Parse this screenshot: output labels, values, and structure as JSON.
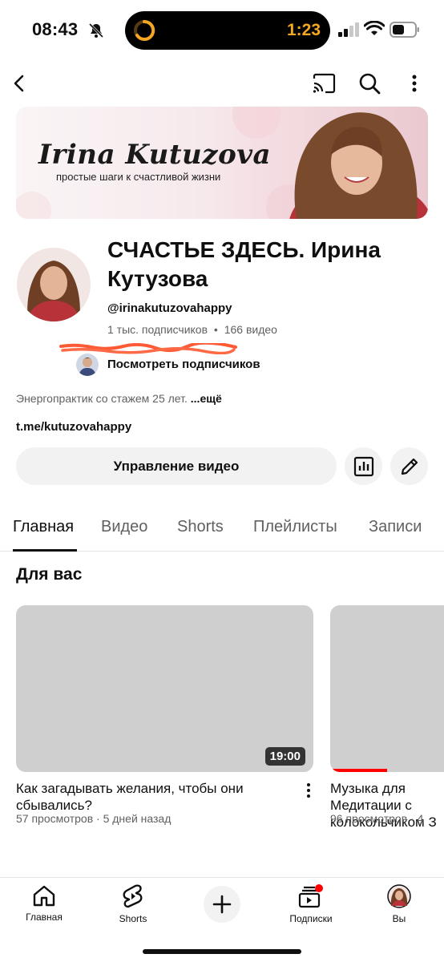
{
  "status_bar": {
    "time": "08:43",
    "timer": "1:23"
  },
  "banner": {
    "title": "Irina Kutuzova",
    "subtitle": "простые шаги к счастливой жизни"
  },
  "channel": {
    "name": "СЧАСТЬЕ ЗДЕСЬ. Ирина Кутузова",
    "handle": "@irinakutuzovahappy",
    "subscribers": "1 тыс. подписчиков",
    "separator": "•",
    "videos_count": "166 видео",
    "see_subscribers": "Посмотреть подписчиков",
    "description": "Энергопрактик со стажем 25 лет.",
    "more": "...ещё",
    "link": "t.me/kutuzovahappy",
    "manage_button": "Управление видео"
  },
  "tabs": [
    "Главная",
    "Видео",
    "Shorts",
    "Плейлисты",
    "Записи"
  ],
  "section": {
    "title": "Для вас"
  },
  "videos": [
    {
      "title": "Как загадывать желания, чтобы они сбывались?",
      "meta": "57 просмотров · 5 дней назад",
      "duration": "19:00",
      "watched_fraction": 0
    },
    {
      "title": "Музыка для Медитации с колокольчиком З",
      "meta": "96 просмотров · 4",
      "duration": "",
      "watched_fraction": 0.5
    }
  ],
  "bottom_nav": {
    "home": "Главная",
    "shorts": "Shorts",
    "subscriptions": "Подписки",
    "you": "Вы"
  },
  "colors": {
    "accent": "#ff0000",
    "timer": "#f5a623",
    "chip_bg": "#f2f2f2"
  }
}
